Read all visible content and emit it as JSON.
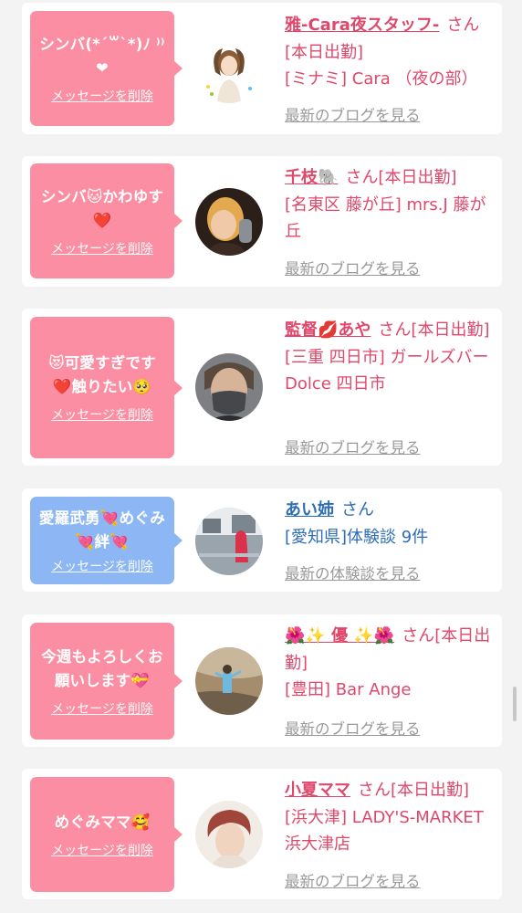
{
  "cards": [
    {
      "bubble": {
        "lines": [
          "シンバ(*´꒳`*)ﾉ ⁾⁾❤"
        ],
        "delete_label": "メッセージを削除"
      },
      "user": {
        "name": "雅-Cara夜スタッフ-",
        "honorific": "さん",
        "status": "[本日出勤]",
        "shop": "[ミナミ] Cara （夜の部）"
      },
      "link": "最新のブログを見る"
    },
    {
      "bubble": {
        "lines": [
          "シンバ🐱かわゆす",
          "❤️"
        ],
        "delete_label": "メッセージを削除"
      },
      "user": {
        "name": "千枝🐘",
        "honorific": "さん",
        "status": "[本日出勤]",
        "shop": "[名東区 藤が丘] mrs.J 藤が丘"
      },
      "link": "最新のブログを見る"
    },
    {
      "bubble": {
        "lines": [
          "😻可愛すぎです",
          "❤️触りたい🥺"
        ],
        "delete_label": "メッセージを削除"
      },
      "user": {
        "name": "監督💋あや",
        "honorific": "さん",
        "status": "[本日出勤]",
        "shop": "[三重 四日市] ガールズバー Dolce 四日市"
      },
      "link": "最新のブログを見る"
    },
    {
      "bubble": {
        "lines": [
          "愛羅武勇💘めぐみ",
          "💘絆💘"
        ],
        "delete_label": "メッセージを削除"
      },
      "user": {
        "name": "あい姉",
        "honorific": "さん",
        "status": "",
        "shop": "[愛知県]体験談 9件"
      },
      "link": "最新の体験談を見る"
    },
    {
      "bubble": {
        "lines": [
          "今週もよろしくお",
          "願いします💝"
        ],
        "delete_label": "メッセージを削除"
      },
      "user": {
        "name": "🌺✨ 優 ✨🌺",
        "honorific": "さん",
        "status": "[本日出勤]",
        "shop": "[豊田] Bar Ange"
      },
      "link": "最新のブログを見る"
    },
    {
      "bubble": {
        "lines": [
          "めぐみママ🥰"
        ],
        "delete_label": "メッセージを削除"
      },
      "user": {
        "name": "小夏ママ",
        "honorific": "さん",
        "status": "[本日出勤]",
        "shop": "[浜大津] LADY'S-MARKET 浜大津店"
      },
      "link": "最新のブログを見る"
    }
  ],
  "colors": {
    "pink_bubble": "#fb8ea2",
    "blue_bubble": "#8db7f4",
    "name_pink": "#e0486b",
    "name_blue": "#2f6db5",
    "link_gray": "#999999"
  }
}
